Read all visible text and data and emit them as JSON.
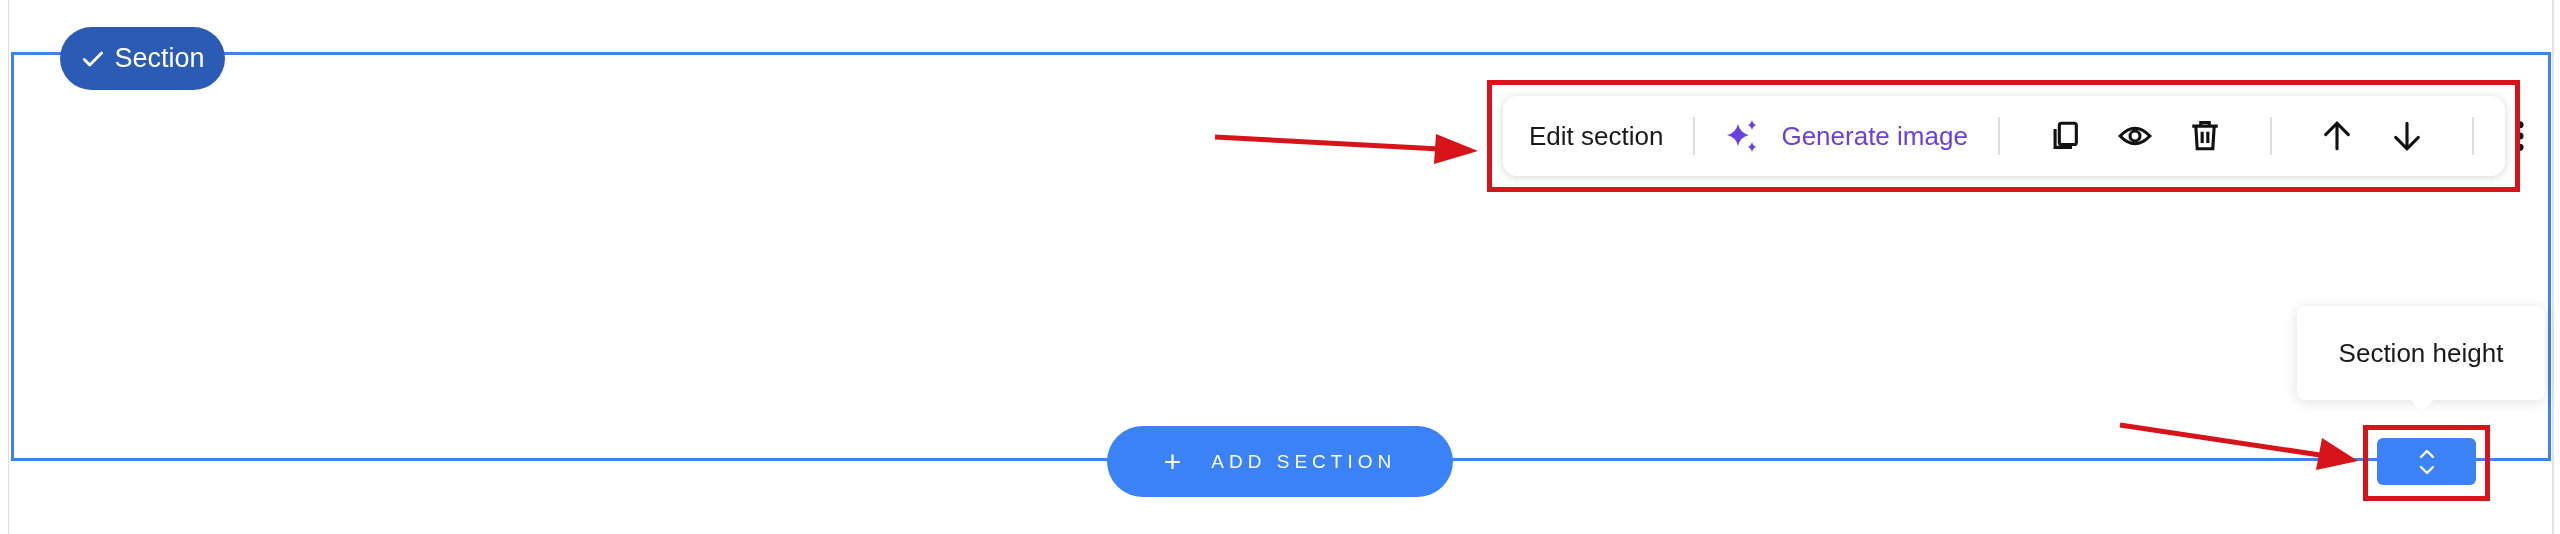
{
  "section_badge": {
    "label": "Section"
  },
  "toolbar": {
    "edit_label": "Edit section",
    "generate_label": "Generate image"
  },
  "add_section": {
    "icon": "+",
    "label": "ADD SECTION"
  },
  "height_tooltip": {
    "text": "Section height"
  }
}
